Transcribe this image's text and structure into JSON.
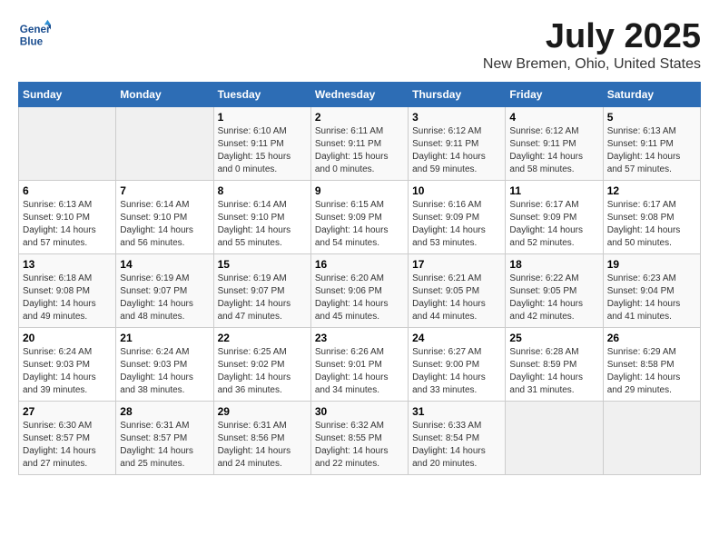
{
  "header": {
    "logo_line1": "General",
    "logo_line2": "Blue",
    "title": "July 2025",
    "subtitle": "New Bremen, Ohio, United States"
  },
  "weekdays": [
    "Sunday",
    "Monday",
    "Tuesday",
    "Wednesday",
    "Thursday",
    "Friday",
    "Saturday"
  ],
  "weeks": [
    [
      {
        "day": "",
        "sunrise": "",
        "sunset": "",
        "daylight": ""
      },
      {
        "day": "",
        "sunrise": "",
        "sunset": "",
        "daylight": ""
      },
      {
        "day": "1",
        "sunrise": "Sunrise: 6:10 AM",
        "sunset": "Sunset: 9:11 PM",
        "daylight": "Daylight: 15 hours and 0 minutes."
      },
      {
        "day": "2",
        "sunrise": "Sunrise: 6:11 AM",
        "sunset": "Sunset: 9:11 PM",
        "daylight": "Daylight: 15 hours and 0 minutes."
      },
      {
        "day": "3",
        "sunrise": "Sunrise: 6:12 AM",
        "sunset": "Sunset: 9:11 PM",
        "daylight": "Daylight: 14 hours and 59 minutes."
      },
      {
        "day": "4",
        "sunrise": "Sunrise: 6:12 AM",
        "sunset": "Sunset: 9:11 PM",
        "daylight": "Daylight: 14 hours and 58 minutes."
      },
      {
        "day": "5",
        "sunrise": "Sunrise: 6:13 AM",
        "sunset": "Sunset: 9:11 PM",
        "daylight": "Daylight: 14 hours and 57 minutes."
      }
    ],
    [
      {
        "day": "6",
        "sunrise": "Sunrise: 6:13 AM",
        "sunset": "Sunset: 9:10 PM",
        "daylight": "Daylight: 14 hours and 57 minutes."
      },
      {
        "day": "7",
        "sunrise": "Sunrise: 6:14 AM",
        "sunset": "Sunset: 9:10 PM",
        "daylight": "Daylight: 14 hours and 56 minutes."
      },
      {
        "day": "8",
        "sunrise": "Sunrise: 6:14 AM",
        "sunset": "Sunset: 9:10 PM",
        "daylight": "Daylight: 14 hours and 55 minutes."
      },
      {
        "day": "9",
        "sunrise": "Sunrise: 6:15 AM",
        "sunset": "Sunset: 9:09 PM",
        "daylight": "Daylight: 14 hours and 54 minutes."
      },
      {
        "day": "10",
        "sunrise": "Sunrise: 6:16 AM",
        "sunset": "Sunset: 9:09 PM",
        "daylight": "Daylight: 14 hours and 53 minutes."
      },
      {
        "day": "11",
        "sunrise": "Sunrise: 6:17 AM",
        "sunset": "Sunset: 9:09 PM",
        "daylight": "Daylight: 14 hours and 52 minutes."
      },
      {
        "day": "12",
        "sunrise": "Sunrise: 6:17 AM",
        "sunset": "Sunset: 9:08 PM",
        "daylight": "Daylight: 14 hours and 50 minutes."
      }
    ],
    [
      {
        "day": "13",
        "sunrise": "Sunrise: 6:18 AM",
        "sunset": "Sunset: 9:08 PM",
        "daylight": "Daylight: 14 hours and 49 minutes."
      },
      {
        "day": "14",
        "sunrise": "Sunrise: 6:19 AM",
        "sunset": "Sunset: 9:07 PM",
        "daylight": "Daylight: 14 hours and 48 minutes."
      },
      {
        "day": "15",
        "sunrise": "Sunrise: 6:19 AM",
        "sunset": "Sunset: 9:07 PM",
        "daylight": "Daylight: 14 hours and 47 minutes."
      },
      {
        "day": "16",
        "sunrise": "Sunrise: 6:20 AM",
        "sunset": "Sunset: 9:06 PM",
        "daylight": "Daylight: 14 hours and 45 minutes."
      },
      {
        "day": "17",
        "sunrise": "Sunrise: 6:21 AM",
        "sunset": "Sunset: 9:05 PM",
        "daylight": "Daylight: 14 hours and 44 minutes."
      },
      {
        "day": "18",
        "sunrise": "Sunrise: 6:22 AM",
        "sunset": "Sunset: 9:05 PM",
        "daylight": "Daylight: 14 hours and 42 minutes."
      },
      {
        "day": "19",
        "sunrise": "Sunrise: 6:23 AM",
        "sunset": "Sunset: 9:04 PM",
        "daylight": "Daylight: 14 hours and 41 minutes."
      }
    ],
    [
      {
        "day": "20",
        "sunrise": "Sunrise: 6:24 AM",
        "sunset": "Sunset: 9:03 PM",
        "daylight": "Daylight: 14 hours and 39 minutes."
      },
      {
        "day": "21",
        "sunrise": "Sunrise: 6:24 AM",
        "sunset": "Sunset: 9:03 PM",
        "daylight": "Daylight: 14 hours and 38 minutes."
      },
      {
        "day": "22",
        "sunrise": "Sunrise: 6:25 AM",
        "sunset": "Sunset: 9:02 PM",
        "daylight": "Daylight: 14 hours and 36 minutes."
      },
      {
        "day": "23",
        "sunrise": "Sunrise: 6:26 AM",
        "sunset": "Sunset: 9:01 PM",
        "daylight": "Daylight: 14 hours and 34 minutes."
      },
      {
        "day": "24",
        "sunrise": "Sunrise: 6:27 AM",
        "sunset": "Sunset: 9:00 PM",
        "daylight": "Daylight: 14 hours and 33 minutes."
      },
      {
        "day": "25",
        "sunrise": "Sunrise: 6:28 AM",
        "sunset": "Sunset: 8:59 PM",
        "daylight": "Daylight: 14 hours and 31 minutes."
      },
      {
        "day": "26",
        "sunrise": "Sunrise: 6:29 AM",
        "sunset": "Sunset: 8:58 PM",
        "daylight": "Daylight: 14 hours and 29 minutes."
      }
    ],
    [
      {
        "day": "27",
        "sunrise": "Sunrise: 6:30 AM",
        "sunset": "Sunset: 8:57 PM",
        "daylight": "Daylight: 14 hours and 27 minutes."
      },
      {
        "day": "28",
        "sunrise": "Sunrise: 6:31 AM",
        "sunset": "Sunset: 8:57 PM",
        "daylight": "Daylight: 14 hours and 25 minutes."
      },
      {
        "day": "29",
        "sunrise": "Sunrise: 6:31 AM",
        "sunset": "Sunset: 8:56 PM",
        "daylight": "Daylight: 14 hours and 24 minutes."
      },
      {
        "day": "30",
        "sunrise": "Sunrise: 6:32 AM",
        "sunset": "Sunset: 8:55 PM",
        "daylight": "Daylight: 14 hours and 22 minutes."
      },
      {
        "day": "31",
        "sunrise": "Sunrise: 6:33 AM",
        "sunset": "Sunset: 8:54 PM",
        "daylight": "Daylight: 14 hours and 20 minutes."
      },
      {
        "day": "",
        "sunrise": "",
        "sunset": "",
        "daylight": ""
      },
      {
        "day": "",
        "sunrise": "",
        "sunset": "",
        "daylight": ""
      }
    ]
  ]
}
